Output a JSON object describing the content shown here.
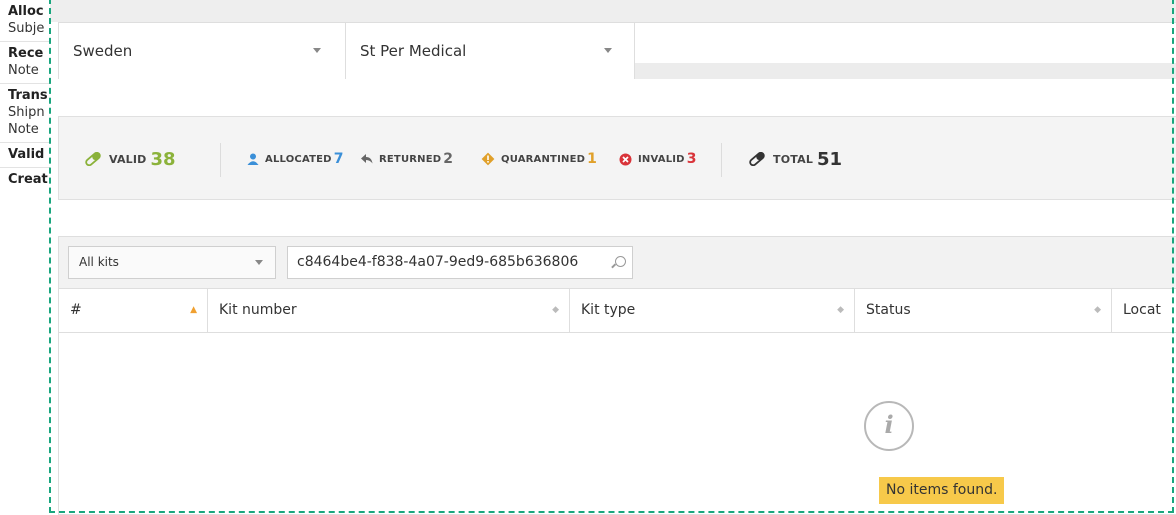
{
  "sidebar": {
    "groups": [
      {
        "title": "Alloc",
        "sub": [
          "Subje"
        ]
      },
      {
        "title": "Rece",
        "sub": [
          "Note"
        ]
      },
      {
        "title": "Trans",
        "sub": [
          "Shipn",
          "Note"
        ]
      },
      {
        "title": "Valid",
        "sub": []
      },
      {
        "title": "Creat",
        "sub": []
      }
    ]
  },
  "filters": {
    "country": "Sweden",
    "site": "St Per Medical"
  },
  "stats": {
    "valid_label": "VALID",
    "valid": "38",
    "allocated_label": "ALLOCATED",
    "allocated": "7",
    "returned_label": "RETURNED",
    "returned": "2",
    "quarantined_label": "QUARANTINED",
    "quarantined": "1",
    "invalid_label": "INVALID",
    "invalid": "3",
    "total_label": "TOTAL",
    "total": "51"
  },
  "colors": {
    "valid": "#8bb23a",
    "allocated": "#3a8fd8",
    "returned": "#666666",
    "quarantined": "#e0a02a",
    "invalid": "#d9343a",
    "total": "#333333",
    "focus_outline": "#19a67e",
    "empty_badge": "#f7c94a"
  },
  "toolbar": {
    "kit_filter": "All kits",
    "search_value": "c8464be4-f838-4a07-9ed9-685b636806"
  },
  "table": {
    "columns": [
      "#",
      "Kit number",
      "Kit type",
      "Status",
      "Locat"
    ],
    "empty_message": "No items found."
  }
}
